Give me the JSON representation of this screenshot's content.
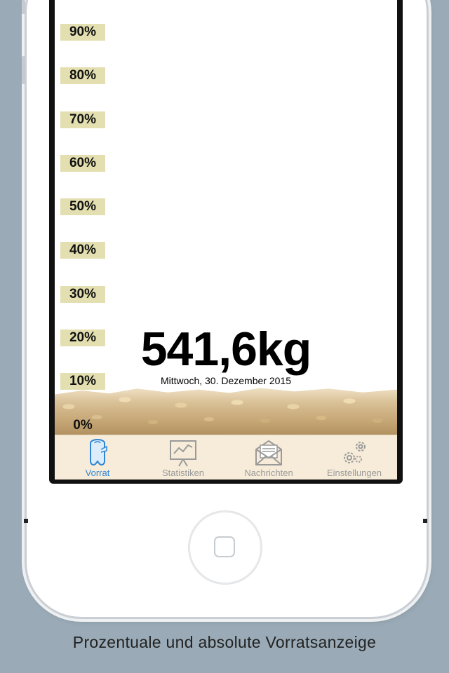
{
  "gauge": {
    "labels": [
      "90%",
      "80%",
      "70%",
      "60%",
      "50%",
      "40%",
      "30%",
      "20%",
      "10%",
      "0%"
    ],
    "fill_level": 0.1
  },
  "stock": {
    "amount": "541,6kg",
    "date": "Mittwoch, 30. Dezember 2015"
  },
  "tabbar": {
    "tabs": [
      {
        "label": "Vorrat",
        "icon": "log-icon",
        "active": true
      },
      {
        "label": "Statistiken",
        "icon": "chart-board-icon",
        "active": false
      },
      {
        "label": "Nachrichten",
        "icon": "envelope-icon",
        "active": false
      },
      {
        "label": "Einstellungen",
        "icon": "gears-icon",
        "active": false
      }
    ]
  },
  "caption": "Prozentuale und absolute Vorratsanzeige",
  "colors": {
    "background": "#9aabb7",
    "gauge_label_bg": "#e3dfb0",
    "tab_active": "#2f86d6",
    "tab_inactive": "#9a9a9a",
    "tabbar_bg": "#f7ecd9"
  }
}
